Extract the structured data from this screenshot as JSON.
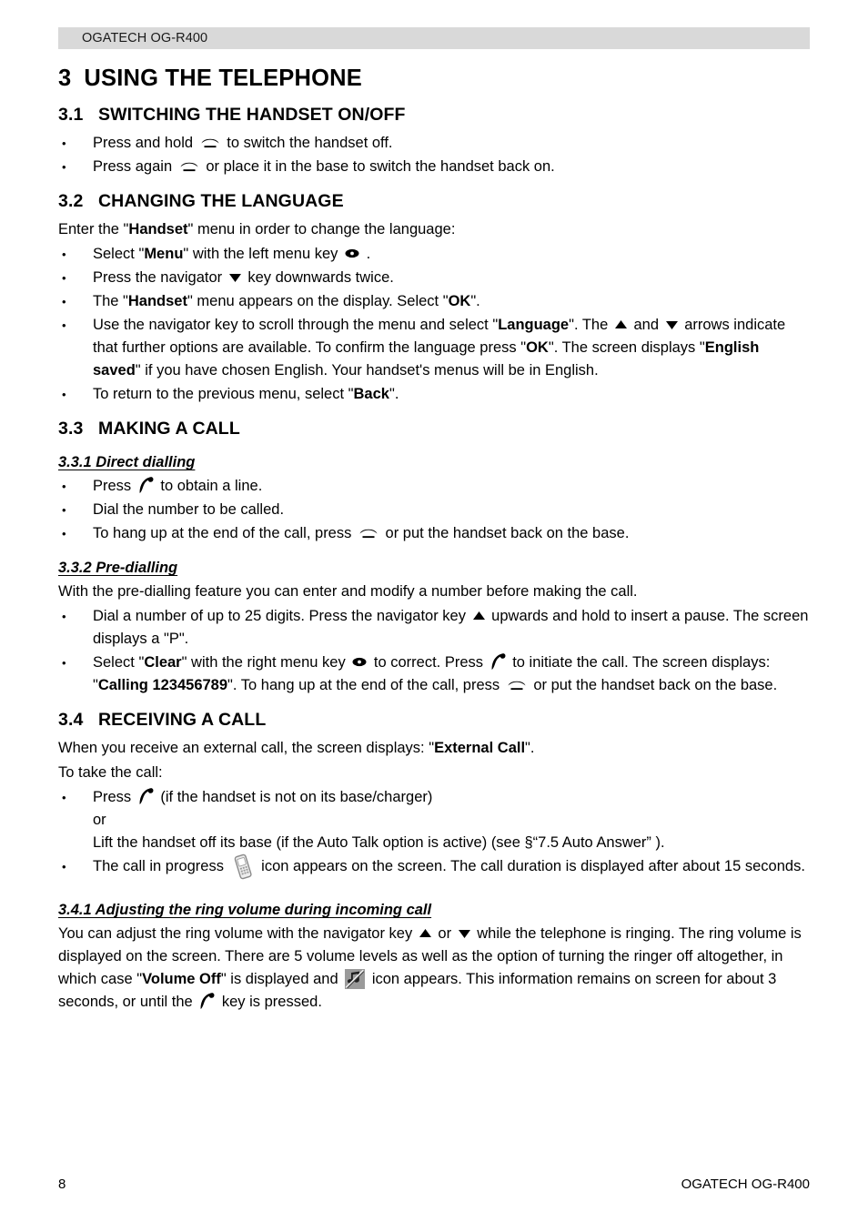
{
  "header": {
    "running_head": "OGATECH OG-R400"
  },
  "chapter": {
    "number": "3",
    "title": "USING THE TELEPHONE"
  },
  "sections": {
    "s31": {
      "number": "3.1",
      "title": "SWITCHING THE HANDSET ON/OFF",
      "b1_a": "Press and hold",
      "b1_b": "to switch the handset off.",
      "b2_a": "Press again",
      "b2_b": "or place it in the base to switch the handset back on."
    },
    "s32": {
      "number": "3.2",
      "title": "CHANGING THE LANGUAGE",
      "intro_a": "Enter the \"",
      "intro_bold": "Handset",
      "intro_b": "\" menu in order to change the language:",
      "b1_a": "Select \"",
      "b1_bold": "Menu",
      "b1_b": "\" with the left menu key",
      "b1_c": ".",
      "b2_a": "Press the navigator",
      "b2_b": "key downwards twice.",
      "b3_a": "The \"",
      "b3_bold1": "Handset",
      "b3_b": "\" menu appears on the display. Select \"",
      "b3_bold2": "OK",
      "b3_c": "\".",
      "b4_a": "Use the navigator key to scroll through the menu and select \"",
      "b4_bold1": "Language",
      "b4_b": "\". The",
      "b4_c": "and",
      "b4_d": "arrows indicate that further options are available. To confirm the language press \"",
      "b4_bold2": "OK",
      "b4_e": "\". The screen displays \"",
      "b4_bold3": "English saved",
      "b4_f": "\" if you have chosen English. Your handset's menus will be in English.",
      "b5_a": "To return to the previous menu, select \"",
      "b5_bold": "Back",
      "b5_b": "\"."
    },
    "s33": {
      "number": "3.3",
      "title": "MAKING A CALL",
      "sub1": {
        "title": "3.3.1 Direct dialling",
        "b1_a": "Press",
        "b1_b": "to obtain a line.",
        "b2": "Dial the number to be called.",
        "b3_a": "To hang up at the end of the call, press",
        "b3_b": "or put the handset back on the base."
      },
      "sub2": {
        "title": "3.3.2 Pre-dialling",
        "intro": "With the pre-dialling feature you can enter and modify a number before making the call.",
        "b1_a": "Dial a number of up to 25 digits. Press the navigator key",
        "b1_b": "upwards and hold to insert a pause. The screen displays a \"P\".",
        "b2_a": "Select \"",
        "b2_bold1": "Clear",
        "b2_b": "\" with the right menu key",
        "b2_c": "to correct. Press",
        "b2_d": "to initiate the call. The screen displays: \"",
        "b2_bold2": "Calling 123456789",
        "b2_e": "\". To hang up at the end of the call, press",
        "b2_f": "or put the handset back on the base."
      }
    },
    "s34": {
      "number": "3.4",
      "title": "RECEIVING A CALL",
      "intro_a": "When you receive an external call, the screen displays: \"",
      "intro_bold": "External Call",
      "intro_b": "\".",
      "intro2": "To take the call:",
      "b1_a": "Press",
      "b1_b": "(if the handset is not on its base/charger)",
      "b1_or": "or",
      "b1_c": "Lift the handset off its base (if the Auto Talk option is active) (see §“7.5 Auto Answer” ).",
      "b2_a": "The call in progress",
      "b2_b": "icon appears on the screen. The call duration is displayed after about 15 seconds.",
      "sub1": {
        "title": "3.4.1 Adjusting the ring volume during incoming call",
        "p_a": "You can adjust the ring volume with the navigator key",
        "p_or": "or",
        "p_b": "while the telephone is ringing. The ring volume is displayed on the screen. There are 5 volume levels as well as the option of turning the ringer off altogether, in which case \"",
        "p_bold": "Volume Off",
        "p_c": "\" is displayed and",
        "p_d": "icon appears. This information remains on screen for about 3 seconds, or until the",
        "p_e": "key is pressed."
      }
    }
  },
  "footer": {
    "page_number": "8",
    "document_title": "OGATECH OG-R400"
  },
  "colors": {
    "header_band": "#d9d9d9",
    "text": "#000000",
    "icon_grey": "#9a9a9a"
  }
}
